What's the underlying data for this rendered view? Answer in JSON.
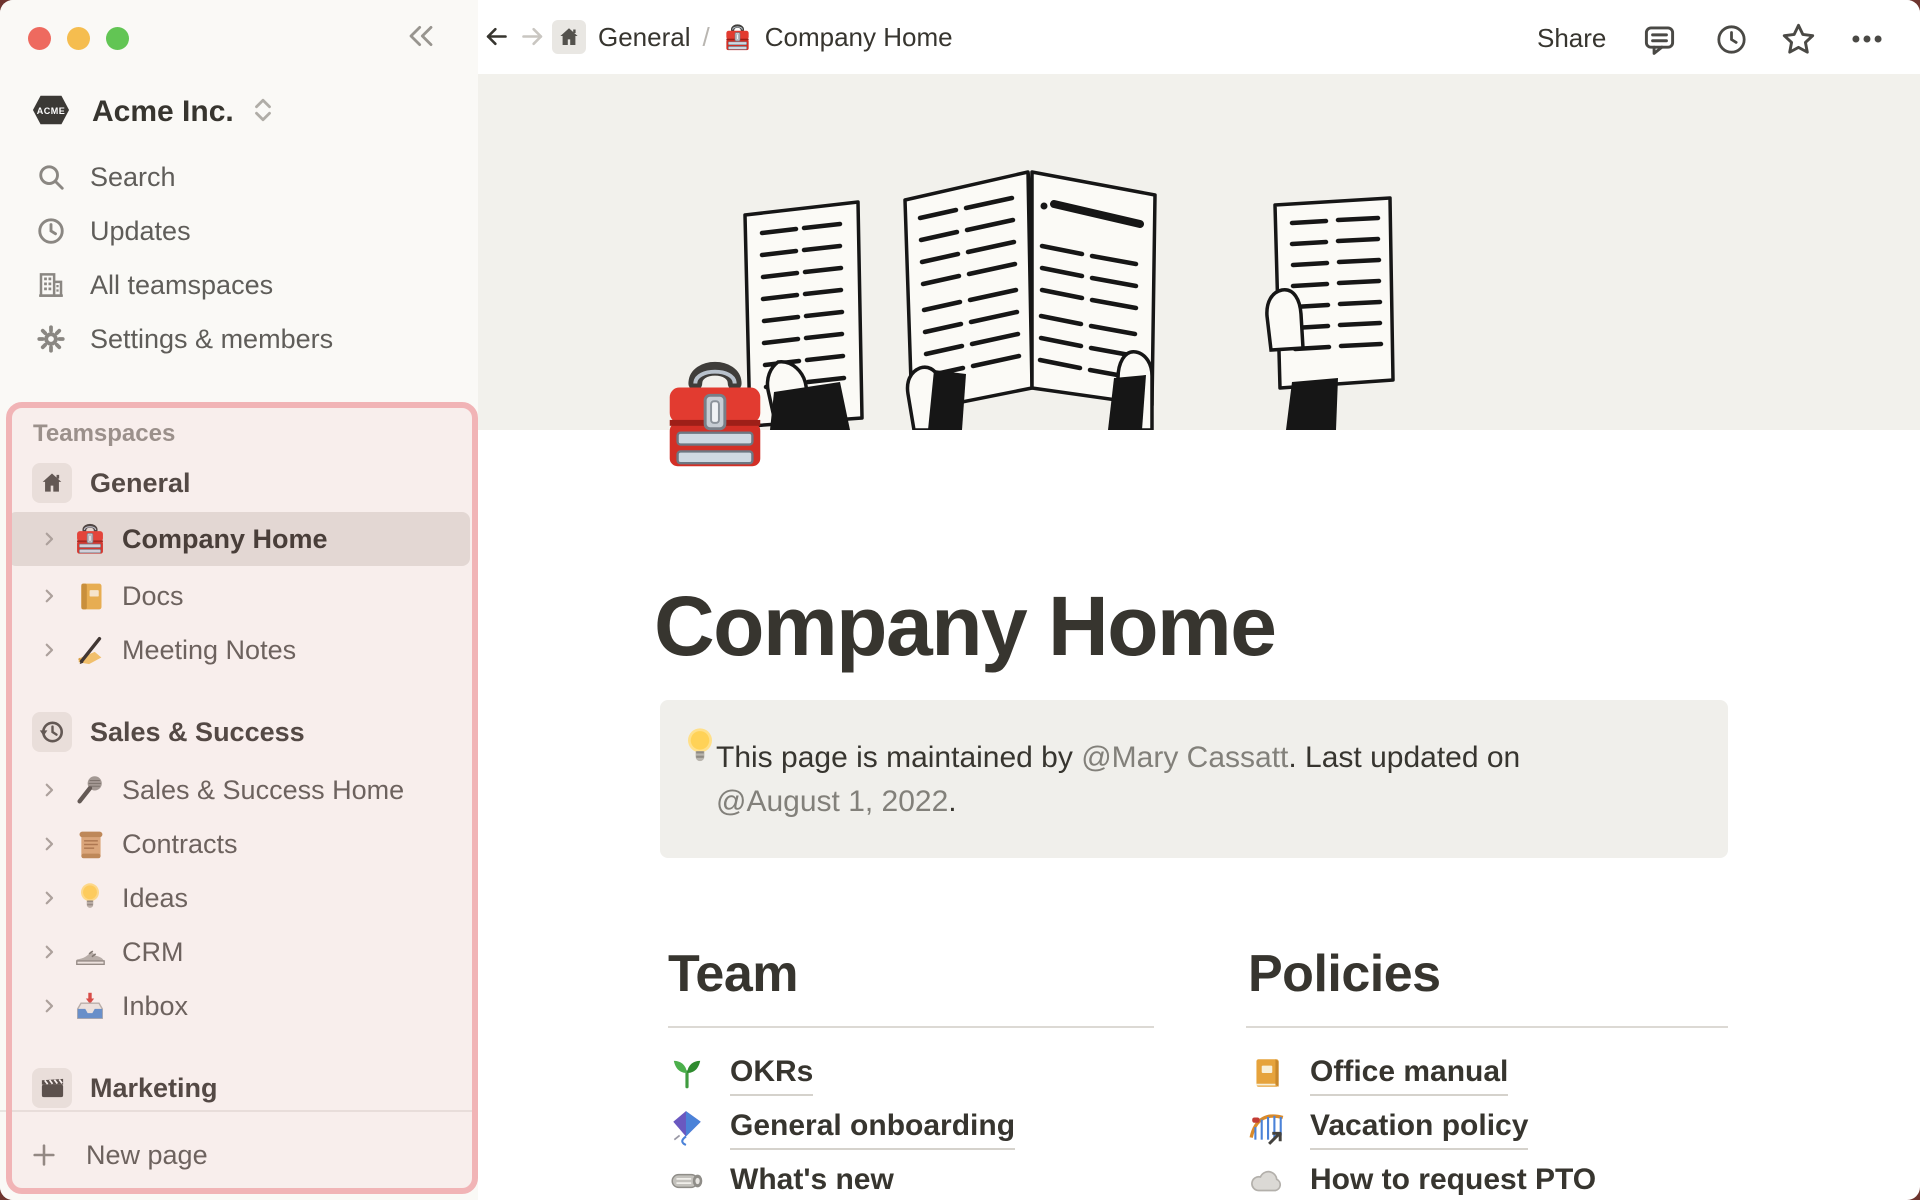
{
  "colors": {
    "desktop": "#6e342e",
    "sidebar_bg": "#faf9f6",
    "selected_row_bg": "#e2dfdb",
    "cover_bg": "#f2f1ec",
    "callout_bg": "#f0efeb",
    "highlight_border": "#f1b4b6",
    "highlight_fill": "rgba(240,150,146,0.10)",
    "traffic_red": "#ee6a5f",
    "traffic_yellow": "#f5bd4f",
    "traffic_green": "#62c554"
  },
  "sidebar": {
    "workspace": {
      "name": "Acme Inc.",
      "logo_text": "ACME",
      "switcher_icon": "chevron-up-down-icon"
    },
    "menu": [
      {
        "label": "Search",
        "icon": "search-icon"
      },
      {
        "label": "Updates",
        "icon": "clock-icon"
      },
      {
        "label": "All teamspaces",
        "icon": "building-icon"
      },
      {
        "label": "Settings & members",
        "icon": "gear-icon"
      }
    ],
    "section_label": "Teamspaces",
    "teamspaces": [
      {
        "label": "General",
        "icon": "house-icon",
        "level": "header"
      },
      {
        "label": "Company Home",
        "icon": "toolbox-emoji",
        "level": "child",
        "selected": true
      },
      {
        "label": "Docs",
        "icon": "ledger-emoji",
        "level": "child"
      },
      {
        "label": "Meeting Notes",
        "icon": "writing-hand-emoji",
        "level": "child"
      },
      {
        "label": "Sales & Success",
        "icon": "history-clock-icon",
        "level": "header"
      },
      {
        "label": "Sales & Success Home",
        "icon": "microphone-emoji",
        "level": "child"
      },
      {
        "label": "Contracts",
        "icon": "scroll-emoji",
        "level": "child"
      },
      {
        "label": "Ideas",
        "icon": "bulb-emoji",
        "level": "child"
      },
      {
        "label": "CRM",
        "icon": "sneaker-emoji",
        "level": "child"
      },
      {
        "label": "Inbox",
        "icon": "inbox-tray-emoji",
        "level": "child"
      },
      {
        "label": "Marketing",
        "icon": "clapper-board-icon",
        "level": "header"
      }
    ],
    "new_page_label": "New page"
  },
  "topbar": {
    "breadcrumb": [
      {
        "label": "General",
        "icon": "house-icon"
      },
      {
        "label": "Company Home",
        "icon": "toolbox-emoji"
      }
    ],
    "separator": "/",
    "share_label": "Share"
  },
  "page": {
    "icon": "toolbox-emoji",
    "title": "Company Home",
    "callout": {
      "icon": "bulb-emoji",
      "line1_prefix": "This page is maintained by ",
      "line1_mention": "@Mary Cassatt",
      "line1_suffix": ". Last updated on",
      "line2_mention": "@August 1, 2022",
      "line2_suffix": "."
    },
    "columns": [
      {
        "heading": "Team",
        "links": [
          {
            "label": "OKRs",
            "icon": "sprout-emoji"
          },
          {
            "label": "General onboarding",
            "icon": "kite-emoji"
          },
          {
            "label": "What's new",
            "icon": "rolled-newspaper-emoji"
          }
        ]
      },
      {
        "heading": "Policies",
        "links": [
          {
            "label": "Office manual",
            "icon": "orange-book-emoji"
          },
          {
            "label": "Vacation policy",
            "icon": "roller-coaster-link-emoji"
          },
          {
            "label": "How to request PTO",
            "icon": "cloud-emoji"
          }
        ]
      }
    ]
  }
}
